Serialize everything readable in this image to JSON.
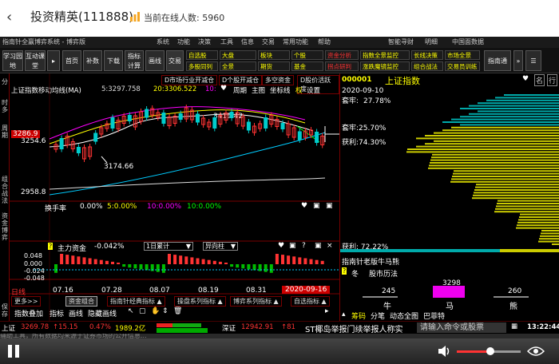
{
  "app": {
    "title": "投资精英(111888)",
    "online_label": "当前在线人数:",
    "online_count": "5960"
  },
  "menubar": {
    "window_title": "指南针全赢博弈系统 - 博弈版",
    "items": [
      "系统",
      "功能",
      "决策",
      "工具",
      "信息",
      "交易",
      "常用功能",
      "帮助"
    ],
    "right_items": [
      "智能寻财",
      "明细",
      "中国面数据"
    ]
  },
  "toolbar": {
    "left_buttons": [
      "学习园地",
      "互动课堂",
      "首页",
      "补数",
      "下载",
      "指标计算",
      "画线",
      "交易"
    ],
    "row1": [
      "自选股",
      "大盘",
      "板块",
      "个股",
      "资金分析",
      "指数全景监控",
      "长线决策",
      "市场全景"
    ],
    "row2": [
      "多股同列",
      "全景",
      "期货",
      "基金",
      "拐点研判",
      "涨跌魔镜监控",
      "组合战法",
      "交易员训练"
    ],
    "right_button": "指南通"
  },
  "chart": {
    "tabs": [
      "D市场行业开减仓",
      "D个股开减仓",
      "多空资金",
      "D股价活跃度"
    ],
    "indicator_name": "上证指数移动均线(MA)",
    "ma5": "5:3297.758",
    "ma20": "20:3306.522",
    "ma10_label": "10:",
    "view_options": [
      "周期",
      "主图",
      "坐标线",
      "权",
      "设置"
    ],
    "price_labels": [
      "3286.9",
      "3254.6",
      "2958.8"
    ],
    "high_label": "3419.42",
    "low_label": "3174.66",
    "turnover_label": "换手率",
    "turnover_values": [
      "0.00%",
      "5:0.00%",
      "10:0.00%",
      "10:0.00%"
    ],
    "mainfund_label": "主力资金",
    "mainfund_value": "-0.042%",
    "mainfund_select": "1日累计",
    "mainfund_select2": "异向柱",
    "mainfund_axis": [
      "0.048",
      "0.000",
      "-0.024",
      "-0.048"
    ],
    "dates": [
      "07.16",
      "07.28",
      "08.07",
      "08.19",
      "08.31",
      "2020-09-16"
    ],
    "period_label": "日线",
    "bottom_buttons": [
      "更多>>",
      "资金组合",
      "指南针经典指标",
      "操盘系列指标",
      "博弈系列指标",
      "自选指标"
    ],
    "bottom_row2": [
      "指数叠加",
      "指标",
      "画线",
      "隐藏画线"
    ]
  },
  "left_strip": [
    "分",
    "时",
    "多",
    "周",
    "期",
    "组",
    "合",
    "战",
    "法",
    "资",
    "金",
    "博",
    "弈",
    "保",
    "存"
  ],
  "right_panel": {
    "code": "000001",
    "name": "上证指数",
    "date": "2020-09-10",
    "trap_label": "套牢:",
    "trap_value": "27.78%",
    "trap2_label": "套牢:",
    "trap2_value": "25.70%",
    "profit_label": "获利:",
    "profit_value": "74.30%",
    "profit2_label": "获利:",
    "profit2_value": "72.22%",
    "note_title": "指南针老版牛马熊",
    "season": "冬",
    "history": "股市历法",
    "bull_val": "245",
    "horse_val": "3298",
    "bear_val": "260",
    "bull": "牛",
    "horse": "马",
    "bear": "熊",
    "tabs": [
      "筹码",
      "分笔",
      "动态全图",
      "巴菲特"
    ],
    "icons": [
      "名",
      "行"
    ]
  },
  "statusbar": {
    "sh_label": "上证",
    "sh_value": "3269.78",
    "sh_change": "15.15",
    "sh_pct": "0.47%",
    "sh_amount": "1989.2亿",
    "sz_label": "深证",
    "sz_value": "12942.91",
    "sz_change": "81",
    "ticker": "ST椰岛举报门续举报人称实",
    "command": "请输入命令或股票",
    "time": "13:22:44"
  },
  "ticker2": "辅助工具，所有数据均来源于证券市场的公开信息..."
}
